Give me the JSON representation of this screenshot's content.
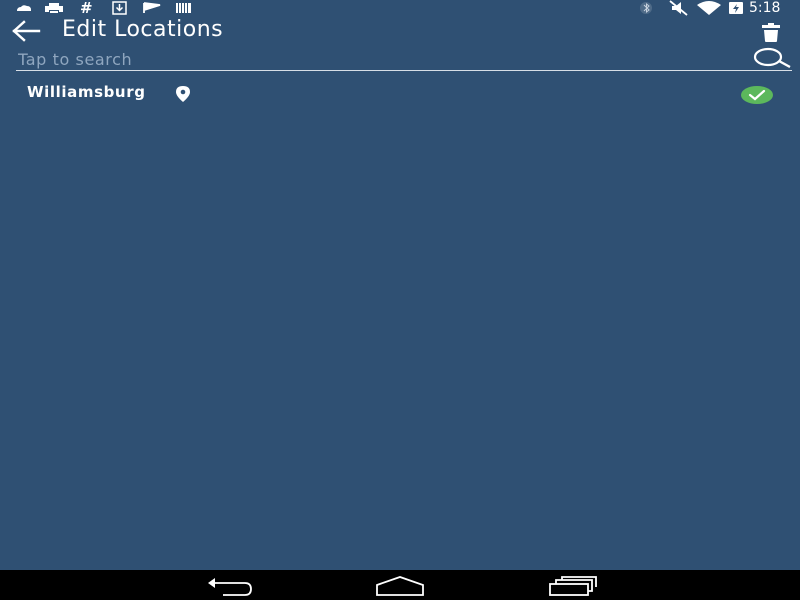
{
  "status_bar": {
    "time": "5:18",
    "left_icons": [
      "cloud-icon",
      "printer-icon",
      "hash-icon",
      "download-icon",
      "flag-icon",
      "barcode-icon"
    ],
    "right_icons": [
      "bluetooth-icon",
      "mute-icon",
      "wifi-icon",
      "battery-charging-icon"
    ]
  },
  "app_bar": {
    "title": "Edit Locations",
    "back_icon": "arrow-left-icon",
    "delete_icon": "trash-icon"
  },
  "search": {
    "placeholder": "Tap to search",
    "value": "",
    "icon": "search-icon"
  },
  "locations": [
    {
      "name": "Williamsburg",
      "current_location": true,
      "selected": true
    }
  ],
  "nav_bar": {
    "icons": [
      "back-nav-icon",
      "home-nav-icon",
      "recents-nav-icon"
    ]
  },
  "colors": {
    "background": "#2f5073",
    "accent_check": "#5cb85c",
    "nav_bar": "#000000",
    "text": "#ffffff"
  }
}
